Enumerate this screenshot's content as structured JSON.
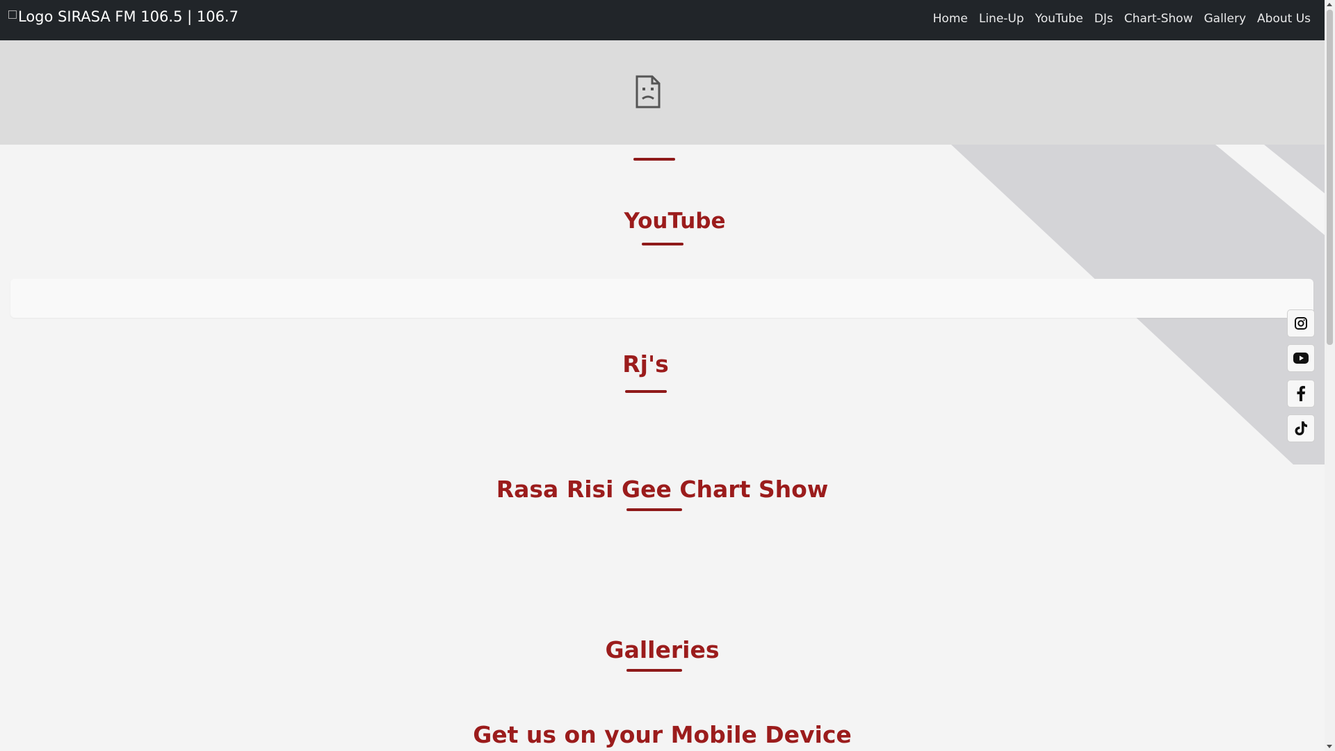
{
  "navbar": {
    "logo_alt": "Logo",
    "brand": "SIRASA FM 106.5 | 106.7",
    "links": [
      "Home",
      "Line-Up",
      "YouTube",
      "DJs",
      "Chart-Show",
      "Gallery",
      "About Us"
    ]
  },
  "sections": {
    "youtube": "YouTube",
    "rjs": "Rj's",
    "chart_show": "Rasa Risi Gee Chart Show",
    "galleries": "Galleries",
    "mobile": "Get us on your Mobile Device"
  },
  "social_icons": [
    "instagram-icon",
    "youtube-icon",
    "facebook-icon",
    "tiktok-icon"
  ],
  "colors": {
    "navbar": "#212529",
    "accent": "#9b1c1c",
    "background": "#f4f4f4",
    "hero": "#dcdcdc"
  }
}
